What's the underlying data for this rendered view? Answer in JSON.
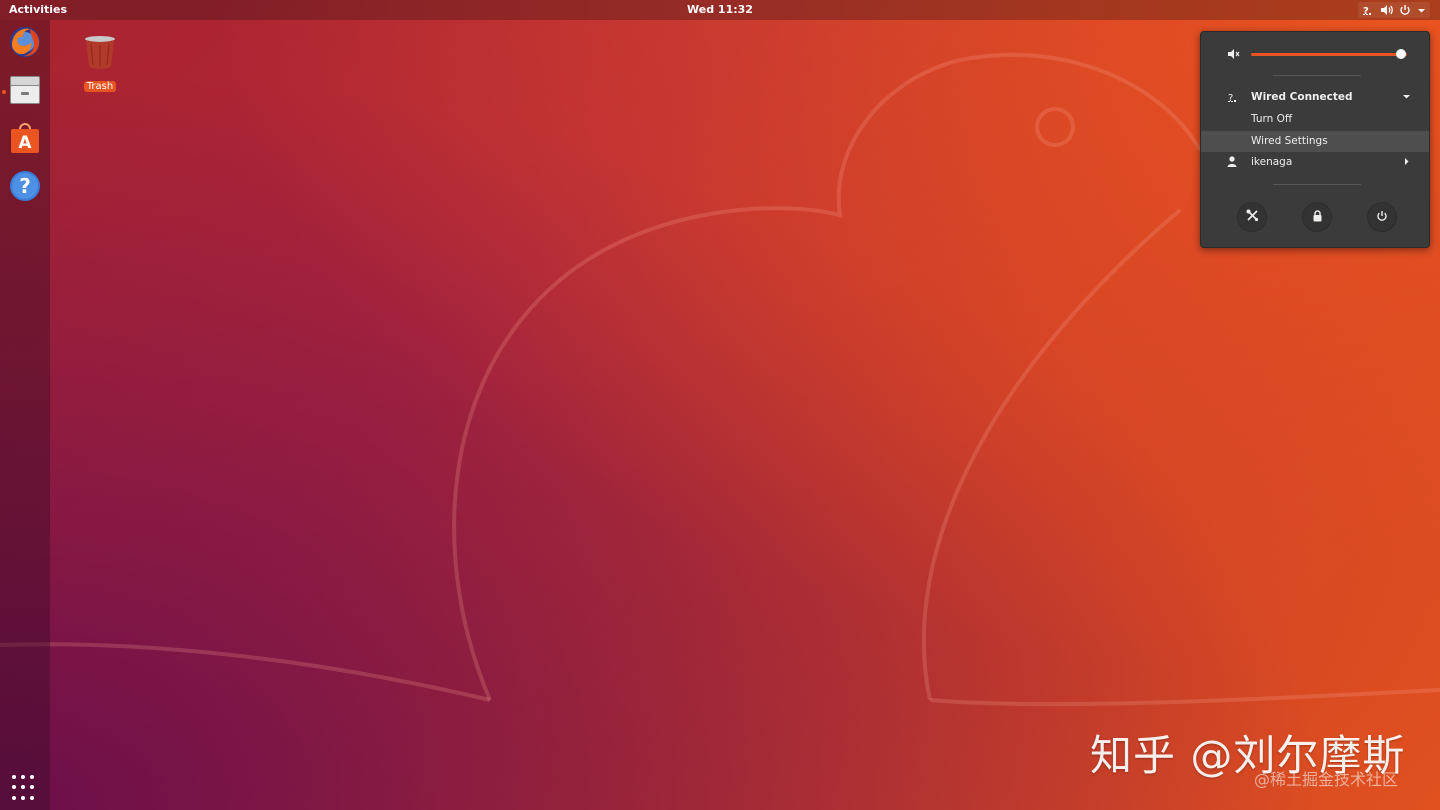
{
  "topbar": {
    "activities_label": "Activities",
    "clock": "Wed 11:32",
    "tray_icons": [
      "network-question-icon",
      "volume-icon",
      "power-icon",
      "chevron-down-icon"
    ]
  },
  "dock": {
    "items": [
      {
        "name": "firefox",
        "icon": "firefox-icon"
      },
      {
        "name": "files",
        "icon": "file-cabinet-icon",
        "running": true
      },
      {
        "name": "software",
        "icon": "software-center-icon"
      },
      {
        "name": "help",
        "icon": "help-icon"
      }
    ],
    "show_apps_icon": "apps-grid-icon"
  },
  "desktop": {
    "trash_label": "Trash"
  },
  "system_menu": {
    "volume_level": 0.96,
    "network": {
      "title": "Wired Connected",
      "turn_off": "Turn Off",
      "settings": "Wired Settings"
    },
    "user": "ikenaga",
    "actions": [
      "settings-icon",
      "lock-icon",
      "power-icon"
    ]
  },
  "watermark": {
    "main": "知乎 @刘尔摩斯",
    "sub": "@稀土掘金技术社区"
  },
  "colors": {
    "accent": "#e95420",
    "menu_bg": "#3b3b3b"
  }
}
